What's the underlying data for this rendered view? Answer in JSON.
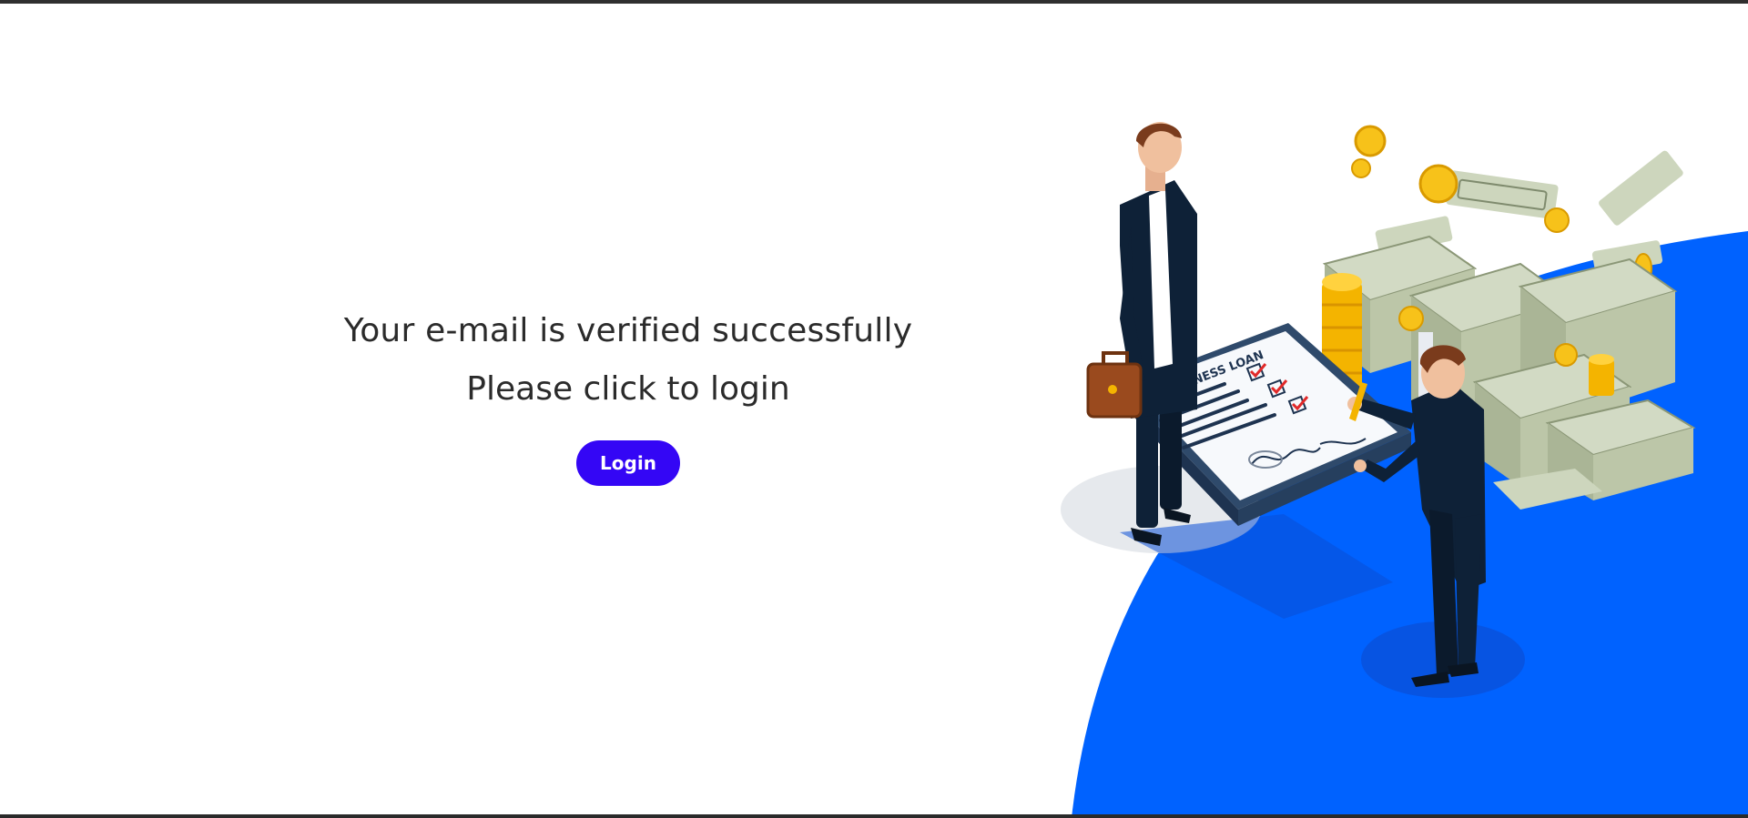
{
  "message": {
    "headline": "Your e-mail is verified successfully",
    "subline": "Please click to login"
  },
  "actions": {
    "login_label": "Login"
  },
  "illustration": {
    "document_title": "BUSINESS LOAN",
    "icons": [
      "businessman-icon",
      "briefcase-icon",
      "loan-document-icon",
      "money-stack-icon",
      "gold-coin-icon",
      "banknote-icon",
      "pen-icon"
    ]
  },
  "colors": {
    "accent": "#3406f5",
    "background_blob": "#0062ff",
    "text": "#2b2b2b",
    "frame": "#2f2f2f"
  }
}
